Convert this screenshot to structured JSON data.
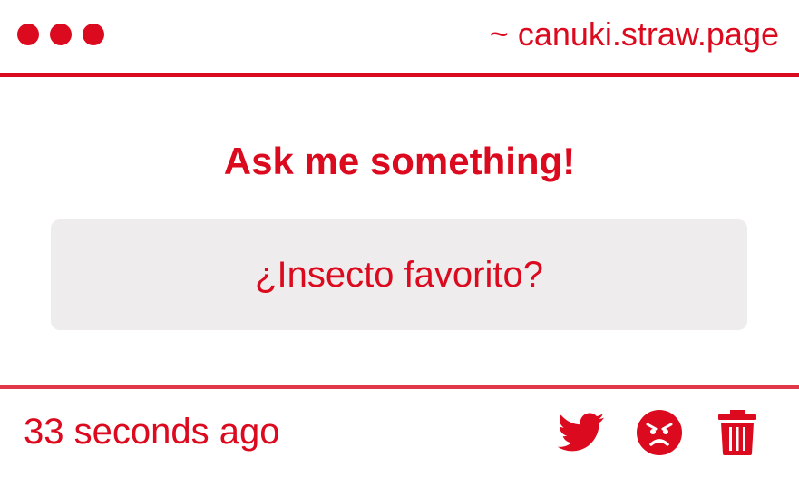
{
  "header": {
    "site_url": "~ canuki.straw.page",
    "dots": [
      "dot",
      "dot",
      "dot"
    ]
  },
  "main": {
    "prompt": "Ask me something!",
    "question": "¿Insecto favorito?"
  },
  "footer": {
    "timestamp": "33 seconds ago",
    "actions": [
      {
        "name": "twitter-share",
        "icon": "twitter-bird-icon"
      },
      {
        "name": "report",
        "icon": "angry-face-icon"
      },
      {
        "name": "delete",
        "icon": "trash-icon"
      }
    ]
  },
  "colors": {
    "accent": "#dc0a1e",
    "question_bg": "#eeecec",
    "background": "#ffffff"
  }
}
